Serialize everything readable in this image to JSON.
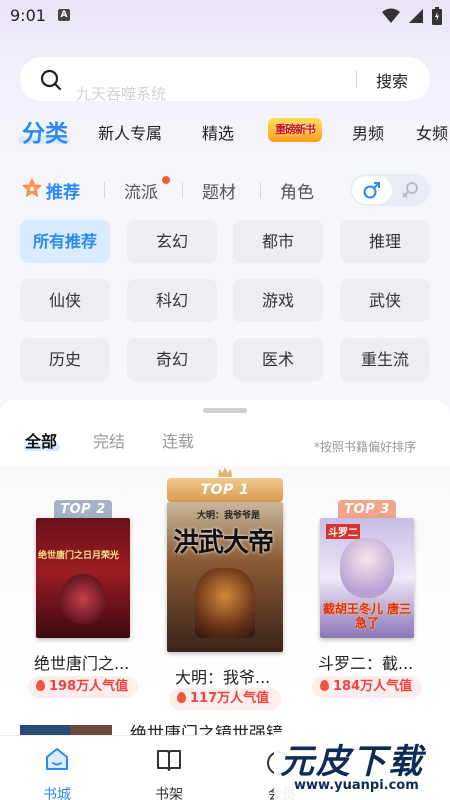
{
  "status_bar": {
    "time": "9:01",
    "notif_letter": "A"
  },
  "search": {
    "placeholder": "九天吞噬系统",
    "button": "搜索"
  },
  "top_tabs": [
    {
      "label": "分类"
    },
    {
      "label": "新人专属"
    },
    {
      "label": "精选"
    },
    {
      "label": "重磅新书"
    },
    {
      "label": "男频"
    },
    {
      "label": "女频"
    }
  ],
  "category_tabs": [
    {
      "label": "推荐"
    },
    {
      "label": "流派"
    },
    {
      "label": "题材"
    },
    {
      "label": "角色"
    }
  ],
  "genres": [
    "所有推荐",
    "玄幻",
    "都市",
    "推理",
    "仙侠",
    "科幻",
    "游戏",
    "武侠",
    "历史",
    "奇幻",
    "医术",
    "重生流"
  ],
  "ranking": {
    "tabs": [
      "全部",
      "完结",
      "连载"
    ],
    "hint": "*按照书籍偏好排序",
    "books": [
      {
        "badge": "TOP 2",
        "title": "绝世唐门之...",
        "cover_text": "绝世唐门之日月荣光",
        "popularity": "198万人气值"
      },
      {
        "badge": "TOP 1",
        "title": "大明：我爷...",
        "cover_text": "洪武大帝",
        "cover_top": "大明：我爷爷是",
        "popularity": "117万人气值"
      },
      {
        "badge": "TOP 3",
        "title": "斗罗二：截...",
        "cover_text": "截胡王冬儿 唐三急了",
        "cover_top": "斗罗二",
        "popularity": "184万人气值"
      }
    ],
    "next_title": "绝世唐门之镜世强镜"
  },
  "bottom_nav": [
    {
      "label": "书城"
    },
    {
      "label": "书架"
    },
    {
      "label": "会员"
    }
  ],
  "watermark": {
    "text": "元皮下载",
    "url": "www.yuanpi.com"
  },
  "colors": {
    "accent": "#2a8af3",
    "hot": "#f0433f"
  }
}
